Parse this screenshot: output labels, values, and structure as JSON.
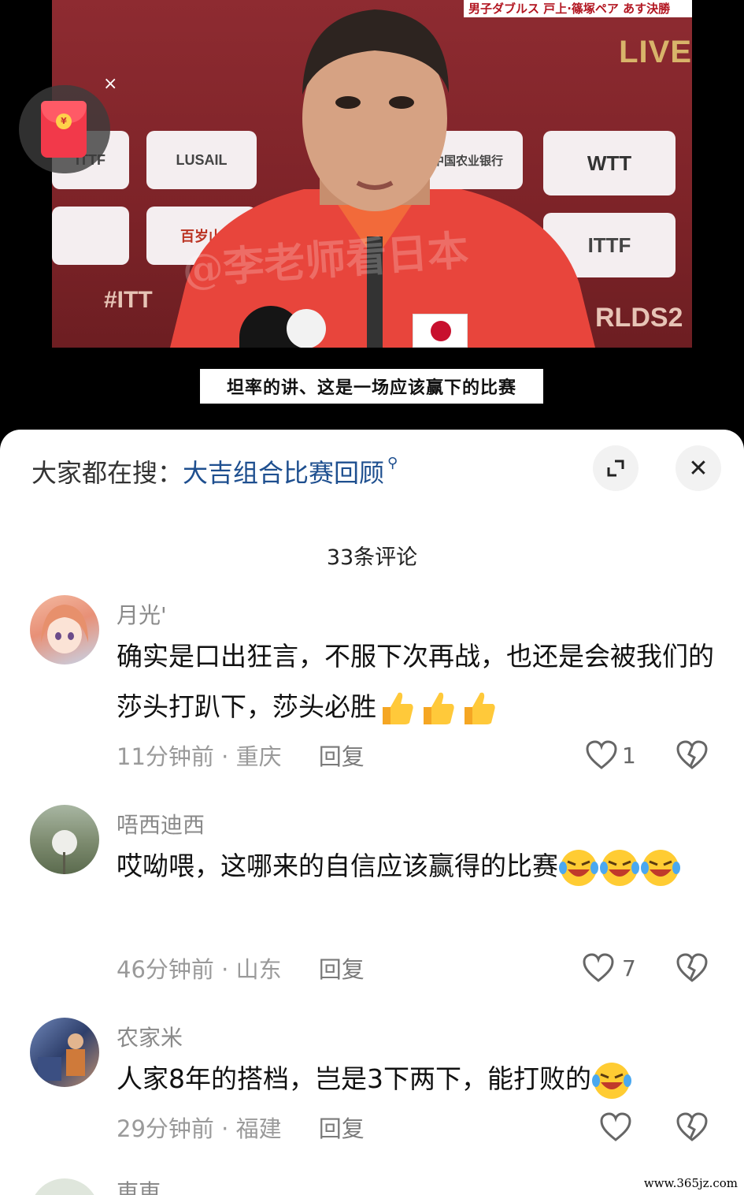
{
  "video": {
    "top_caption": "男子ダブルス 戸上·篠塚ペア あす決勝",
    "live_badge": "LIVE",
    "watermark": "@李老师看日本",
    "subtitle": "坦率的讲、这是一场应该赢下的比赛",
    "sponsors": [
      "ITTF",
      "LUSAIL",
      "中国农业银行",
      "WTT",
      "百岁山",
      "ITTF",
      "#ITT",
      "RLDS2"
    ],
    "redpacket_coin": "¥",
    "redpacket_close": "×"
  },
  "sheet": {
    "search_label": "大家都在搜：",
    "search_link": "大吉组合比赛回顾",
    "search_glyph": "⚲",
    "expand_icon": "expand-icon",
    "close_glyph": "✕",
    "comment_count": "33条评论"
  },
  "comments": [
    {
      "user": "月光'",
      "text": "确实是口出狂言，不服下次再战，也还是会被我们的莎头打趴下，莎头必胜",
      "emojis": [
        "thumbs-up-icon",
        "thumbs-up-icon",
        "thumbs-up-icon"
      ],
      "time": "11分钟前",
      "location": "重庆",
      "reply": "回复",
      "likes": "1"
    },
    {
      "user": "唔西迪西",
      "text": "哎呦喂，这哪来的自信应该赢得的比赛",
      "emojis": [
        "laugh-cry-icon",
        "laugh-cry-icon",
        "laugh-cry-icon"
      ],
      "time": "46分钟前",
      "location": "山东",
      "reply": "回复",
      "likes": "7"
    },
    {
      "user": "农家米",
      "text": "人家8年的搭档，岂是3下两下，能打败的",
      "emojis": [
        "laugh-cry-icon"
      ],
      "time": "29分钟前",
      "location": "福建",
      "reply": "回复",
      "likes": ""
    },
    {
      "user": "東東"
    }
  ],
  "separator": " · ",
  "site_mark": "www.365jz.com",
  "colors": {
    "link": "#1e4f8f",
    "frame_red": "#8e2b31",
    "packet_red": "#f2394a"
  }
}
